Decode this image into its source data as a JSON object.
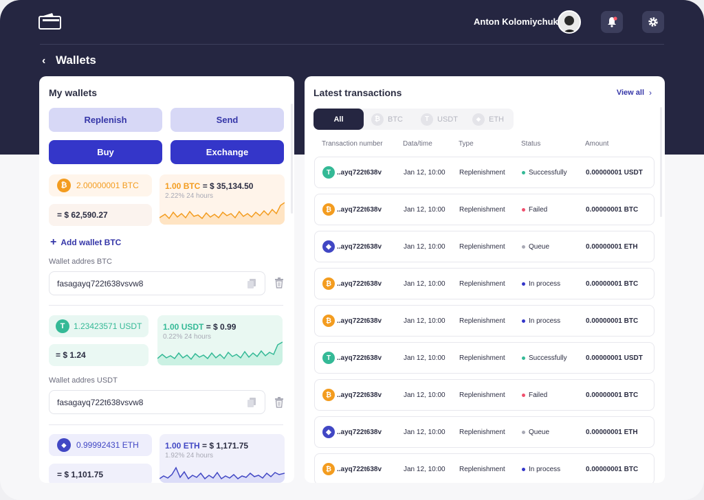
{
  "header": {
    "user_name": "Anton Kolomiychuk",
    "icons": [
      "wallet-logo-icon",
      "bell-icon",
      "gear-icon"
    ],
    "notification_dot_color": "#ff5a6a"
  },
  "page": {
    "back_symbol": "‹",
    "title": "Wallets"
  },
  "left": {
    "title": "My wallets",
    "buttons": {
      "replenish": "Replenish",
      "send": "Send",
      "buy": "Buy",
      "exchange": "Exchange"
    },
    "wallets": [
      {
        "coin": "BTC",
        "symbol": "₿",
        "balance": "2.00000001 BTC",
        "fiat": "= $ 62,590.27",
        "rate_prefix": "1.00 BTC",
        "rate_value": "= $ 35,134.50",
        "change": "2.22% 24 hours",
        "color": "#f39c1f",
        "add_link": "Add wallet BTC",
        "address_label": "Wallet addres BTC",
        "address": "fasagayq722t638vsvw8"
      },
      {
        "coin": "USDT",
        "symbol": "T",
        "balance": "1.23423571 USDT",
        "fiat": "= $ 1.24",
        "rate_prefix": "1.00 USDT",
        "rate_value": "= $ 0.99",
        "change": "0.22% 24 hours",
        "color": "#34b996",
        "address_label": "Wallet addres USDT",
        "address": "fasagayq722t638vsvw8"
      },
      {
        "coin": "ETH",
        "symbol": "◆",
        "balance": "0.99992431 ETH",
        "fiat": "= $ 1,101.75",
        "rate_prefix": "1.00 ETH",
        "rate_value": "= $ 1,171.75",
        "change": "1.92% 24 hours",
        "color": "#4147c4"
      }
    ]
  },
  "right": {
    "title": "Latest transactions",
    "view_all": "View all",
    "tabs": [
      {
        "label": "All",
        "symbol": ""
      },
      {
        "label": "BTC",
        "symbol": "₿"
      },
      {
        "label": "USDT",
        "symbol": "T"
      },
      {
        "label": "ETH",
        "symbol": "◆"
      }
    ],
    "columns": [
      "Transaction number",
      "Data/time",
      "Type",
      "Status",
      "Amount"
    ],
    "rows": [
      {
        "coin": "usdt",
        "symbol": "T",
        "number": "..ayq722t638v",
        "date": "Jan 12, 10:00",
        "type": "Replenishment",
        "status": "Successfully",
        "status_color": "#34b996",
        "amount": "0.00000001 USDT"
      },
      {
        "coin": "btc",
        "symbol": "₿",
        "number": "..ayq722t638v",
        "date": "Jan 12, 10:00",
        "type": "Replenishment",
        "status": "Failed",
        "status_color": "#f0506e",
        "amount": "0.00000001 BTC"
      },
      {
        "coin": "eth",
        "symbol": "◆",
        "number": "..ayq722t638v",
        "date": "Jan 12, 10:00",
        "type": "Replenishment",
        "status": "Queue",
        "status_color": "#a8a9b5",
        "amount": "0.00000001 ETH"
      },
      {
        "coin": "btc",
        "symbol": "₿",
        "number": "..ayq722t638v",
        "date": "Jan 12, 10:00",
        "type": "Replenishment",
        "status": "In process",
        "status_color": "#3436c9",
        "amount": "0.00000001 BTC"
      },
      {
        "coin": "btc",
        "symbol": "₿",
        "number": "..ayq722t638v",
        "date": "Jan 12, 10:00",
        "type": "Replenishment",
        "status": "In process",
        "status_color": "#3436c9",
        "amount": "0.00000001 BTC"
      },
      {
        "coin": "usdt",
        "symbol": "T",
        "number": "..ayq722t638v",
        "date": "Jan 12, 10:00",
        "type": "Replenishment",
        "status": "Successfully",
        "status_color": "#34b996",
        "amount": "0.00000001 USDT"
      },
      {
        "coin": "btc",
        "symbol": "₿",
        "number": "..ayq722t638v",
        "date": "Jan 12, 10:00",
        "type": "Replenishment",
        "status": "Failed",
        "status_color": "#f0506e",
        "amount": "0.00000001 BTC"
      },
      {
        "coin": "eth",
        "symbol": "◆",
        "number": "..ayq722t638v",
        "date": "Jan 12, 10:00",
        "type": "Replenishment",
        "status": "Queue",
        "status_color": "#a8a9b5",
        "amount": "0.00000001 ETH"
      },
      {
        "coin": "btc",
        "symbol": "₿",
        "number": "..ayq722t638v",
        "date": "Jan 12, 10:00",
        "type": "Replenishment",
        "status": "In process",
        "status_color": "#3436c9",
        "amount": "0.00000001 BTC"
      }
    ]
  }
}
